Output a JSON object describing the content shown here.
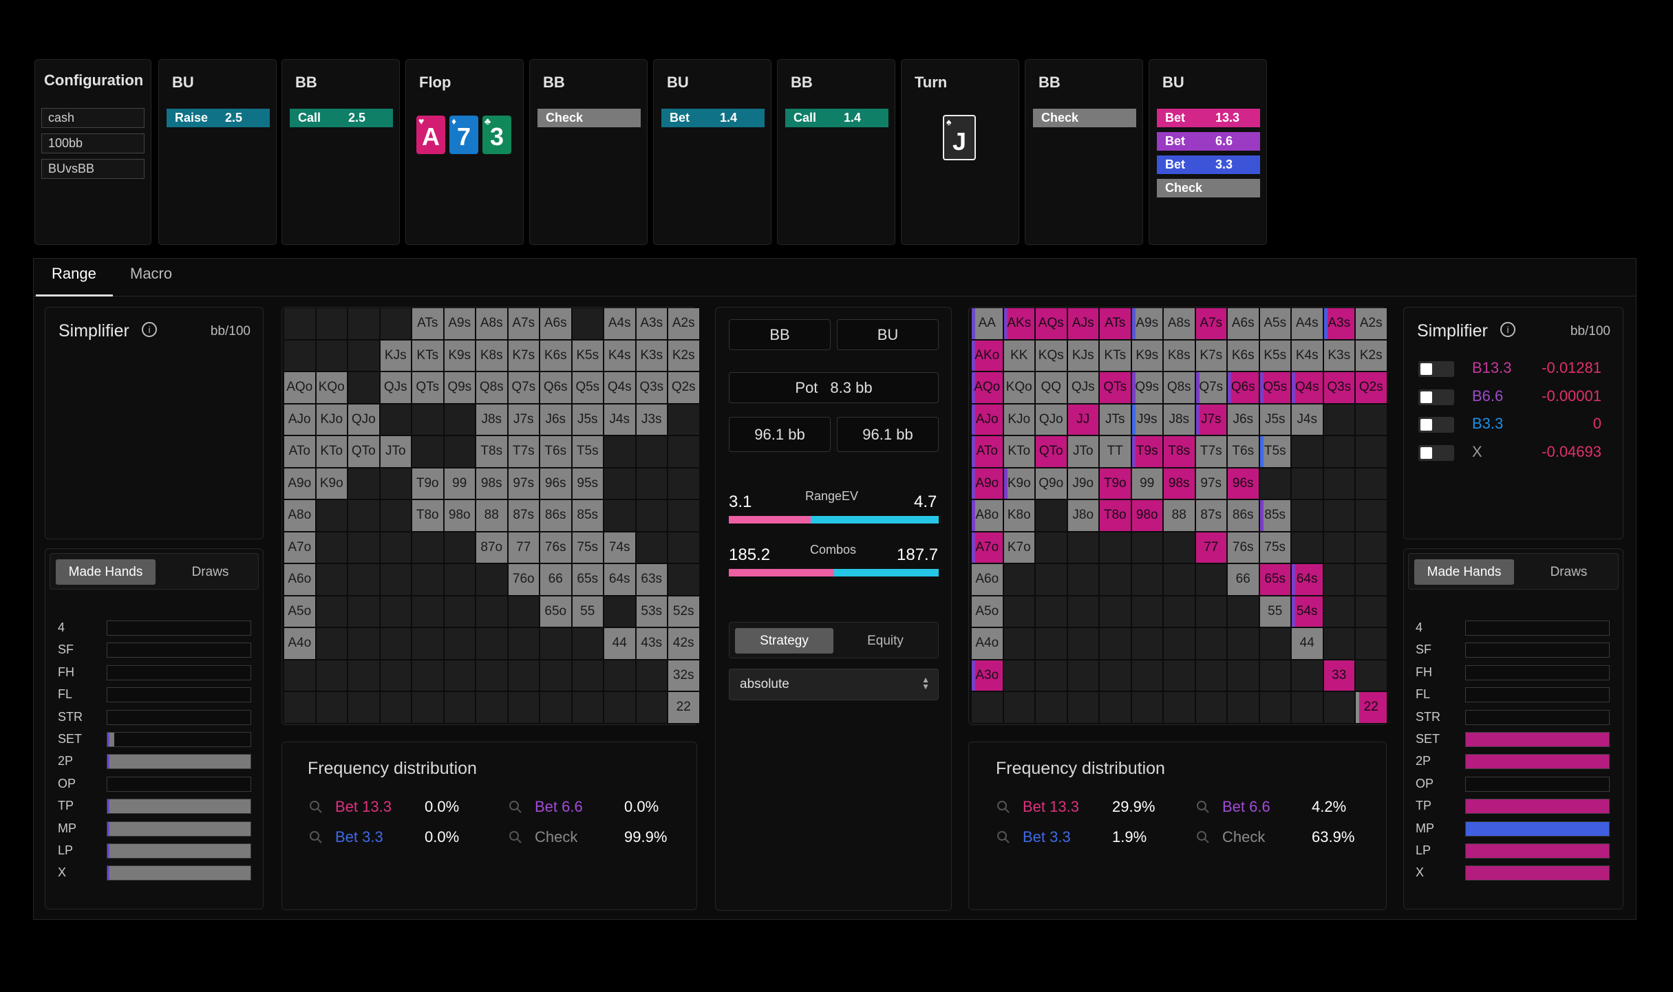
{
  "config": {
    "title": "Configuration",
    "items": [
      "cash",
      "100bb",
      "BUvsBB"
    ]
  },
  "nodes": [
    {
      "title": "BU",
      "actions": [
        {
          "label": "Raise",
          "value": "2.5",
          "color": "#0f7286"
        }
      ]
    },
    {
      "title": "BB",
      "actions": [
        {
          "label": "Call",
          "value": "2.5",
          "color": "#0f7f67"
        }
      ]
    },
    {
      "title": "Flop",
      "cards": [
        {
          "rank": "A",
          "suit": "♥",
          "color": "#d21d73"
        },
        {
          "rank": "7",
          "suit": "♦",
          "color": "#1679c9"
        },
        {
          "rank": "3",
          "suit": "♣",
          "color": "#11885a"
        }
      ]
    },
    {
      "title": "BB",
      "actions": [
        {
          "label": "Check",
          "value": "",
          "color": "#7a7a7a"
        }
      ]
    },
    {
      "title": "BU",
      "actions": [
        {
          "label": "Bet",
          "value": "1.4",
          "color": "#0f7286"
        }
      ]
    },
    {
      "title": "BB",
      "actions": [
        {
          "label": "Call",
          "value": "1.4",
          "color": "#0f7f67"
        }
      ]
    },
    {
      "title": "Turn",
      "cards": [
        {
          "rank": "J",
          "suit": "♠",
          "color": "#2a2a2a"
        }
      ]
    },
    {
      "title": "BB",
      "actions": [
        {
          "label": "Check",
          "value": "",
          "color": "#7a7a7a"
        }
      ]
    },
    {
      "title": "BU",
      "actions": [
        {
          "label": "Bet",
          "value": "13.3",
          "color": "#d2268a"
        },
        {
          "label": "Bet",
          "value": "6.6",
          "color": "#9b3bc4"
        },
        {
          "label": "Bet",
          "value": "3.3",
          "color": "#3c55d8"
        },
        {
          "label": "Check",
          "value": "",
          "color": "#7a7a7a"
        }
      ]
    }
  ],
  "tabs": {
    "range": "Range",
    "macro": "Macro"
  },
  "left": {
    "simplifier": "Simplifier",
    "unit": "bb/100",
    "seg": {
      "a": "Made Hands",
      "b": "Draws"
    },
    "hist": [
      {
        "label": "4",
        "fill": 0
      },
      {
        "label": "SF",
        "fill": 0
      },
      {
        "label": "FH",
        "fill": 0
      },
      {
        "label": "FL",
        "fill": 0
      },
      {
        "label": "STR",
        "fill": 0
      },
      {
        "label": "SET",
        "fill": 0.05
      },
      {
        "label": "2P",
        "fill": 1
      },
      {
        "label": "OP",
        "fill": 0
      },
      {
        "label": "TP",
        "fill": 1
      },
      {
        "label": "MP",
        "fill": 1
      },
      {
        "label": "LP",
        "fill": 1
      },
      {
        "label": "X",
        "fill": 1
      }
    ],
    "fd": {
      "title": "Frequency distribution",
      "items": [
        {
          "label": "Bet 13.3",
          "value": "0.0%",
          "color": "#e0317f"
        },
        {
          "label": "Bet 6.6",
          "value": "0.0%",
          "color": "#a44bd8"
        },
        {
          "label": "Bet 3.3",
          "value": "0.0%",
          "color": "#3f6ae8"
        },
        {
          "label": "Check",
          "value": "99.9%",
          "color": "#8a8a8a"
        }
      ]
    }
  },
  "center": {
    "players": [
      "BB",
      "BU"
    ],
    "pot_label": "Pot",
    "pot_value": "8.3 bb",
    "stacks": [
      "96.1 bb",
      "96.1 bb"
    ],
    "rangeev": {
      "label": "RangeEV",
      "left": "3.1",
      "right": "4.7"
    },
    "combos": {
      "label": "Combos",
      "left": "185.2",
      "right": "187.7"
    },
    "seg": {
      "a": "Strategy",
      "b": "Equity"
    },
    "select": "absolute"
  },
  "right": {
    "simplifier": "Simplifier",
    "unit": "bb/100",
    "rows": [
      {
        "label": "B13.3",
        "value": "-0.01281",
        "color": "#c43a9c",
        "vcolor": "#e0306e"
      },
      {
        "label": "B6.6",
        "value": "-0.00001",
        "color": "#9b4ccc",
        "vcolor": "#e0306e"
      },
      {
        "label": "B3.3",
        "value": "0",
        "color": "#1e90e8",
        "vcolor": "#e0306e"
      },
      {
        "label": "X",
        "value": "-0.04693",
        "color": "#9a9a9a",
        "vcolor": "#e0306e"
      }
    ],
    "seg": {
      "a": "Made Hands",
      "b": "Draws"
    },
    "hist": [
      {
        "label": "4",
        "fill": 0
      },
      {
        "label": "SF",
        "fill": 0
      },
      {
        "label": "FH",
        "fill": 0
      },
      {
        "label": "FL",
        "fill": 0
      },
      {
        "label": "STR",
        "fill": 0
      },
      {
        "label": "SET",
        "fill": 1
      },
      {
        "label": "2P",
        "fill": 1
      },
      {
        "label": "OP",
        "fill": 0
      },
      {
        "label": "TP",
        "fill": 1
      },
      {
        "label": "MP",
        "fill": 1
      },
      {
        "label": "LP",
        "fill": 1
      },
      {
        "label": "X",
        "fill": 1
      }
    ],
    "fd": {
      "title": "Frequency distribution",
      "items": [
        {
          "label": "Bet 13.3",
          "value": "29.9%",
          "color": "#e0317f"
        },
        {
          "label": "Bet 6.6",
          "value": "4.2%",
          "color": "#a44bd8"
        },
        {
          "label": "Bet 3.3",
          "value": "1.9%",
          "color": "#3f6ae8"
        },
        {
          "label": "Check",
          "value": "63.9%",
          "color": "#8a8a8a"
        }
      ]
    }
  },
  "grid_left": [
    [
      "",
      "",
      "",
      "",
      "ATs",
      "A9s",
      "A8s",
      "A7s",
      "A6s",
      "",
      "A4s",
      "A3s",
      "A2s"
    ],
    [
      "",
      "",
      "",
      "KJs",
      "KTs",
      "K9s",
      "K8s",
      "K7s",
      "K6s",
      "K5s",
      "K4s",
      "K3s",
      "K2s"
    ],
    [
      "AQo",
      "KQo",
      "",
      "QJs",
      "QTs",
      "Q9s",
      "Q8s",
      "Q7s",
      "Q6s",
      "Q5s",
      "Q4s",
      "Q3s",
      "Q2s"
    ],
    [
      "AJo",
      "KJo",
      "QJo",
      "",
      "",
      "",
      "J8s",
      "J7s",
      "J6s",
      "J5s",
      "J4s",
      "J3s",
      ""
    ],
    [
      "ATo",
      "KTo",
      "QTo",
      "JTo",
      "",
      "",
      "T8s",
      "T7s",
      "T6s",
      "T5s",
      "",
      "",
      ""
    ],
    [
      "A9o",
      "K9o",
      "",
      "",
      "T9o",
      "99",
      "98s",
      "97s",
      "96s",
      "95s",
      "",
      "",
      ""
    ],
    [
      "A8o",
      "",
      "",
      "",
      "T8o",
      "98o",
      "88",
      "87s",
      "86s",
      "85s",
      "",
      "",
      ""
    ],
    [
      "A7o",
      "",
      "",
      "",
      "",
      "",
      "87o",
      "77",
      "76s",
      "75s",
      "74s",
      "",
      ""
    ],
    [
      "A6o",
      "",
      "",
      "",
      "",
      "",
      "",
      "76o",
      "66",
      "65s",
      "64s",
      "63s",
      ""
    ],
    [
      "A5o",
      "",
      "",
      "",
      "",
      "",
      "",
      "",
      "65o",
      "55",
      "",
      "53s",
      "52s"
    ],
    [
      "A4o",
      "",
      "",
      "",
      "",
      "",
      "",
      "",
      "",
      "",
      "44",
      "43s",
      "42s"
    ],
    [
      "",
      "",
      "",
      "",
      "",
      "",
      "",
      "",
      "",
      "",
      "",
      "",
      "32s"
    ],
    [
      "",
      "",
      "",
      "",
      "",
      "",
      "",
      "",
      "",
      "",
      "",
      "",
      "22"
    ]
  ],
  "grid_right": [
    [
      "AA",
      "AKs",
      "AQs",
      "AJs",
      "ATs",
      "A9s",
      "A8s",
      "A7s",
      "A6s",
      "A5s",
      "A4s",
      "A3s",
      "A2s"
    ],
    [
      "AKo",
      "KK",
      "KQs",
      "KJs",
      "KTs",
      "K9s",
      "K8s",
      "K7s",
      "K6s",
      "K5s",
      "K4s",
      "K3s",
      "K2s"
    ],
    [
      "AQo",
      "KQo",
      "QQ",
      "QJs",
      "QTs",
      "Q9s",
      "Q8s",
      "Q7s",
      "Q6s",
      "Q5s",
      "Q4s",
      "Q3s",
      "Q2s"
    ],
    [
      "AJo",
      "KJo",
      "QJo",
      "JJ",
      "JTs",
      "J9s",
      "J8s",
      "J7s",
      "J6s",
      "J5s",
      "J4s",
      "",
      ""
    ],
    [
      "ATo",
      "KTo",
      "QTo",
      "JTo",
      "TT",
      "T9s",
      "T8s",
      "T7s",
      "T6s",
      "T5s",
      "",
      "",
      ""
    ],
    [
      "A9o",
      "K9o",
      "Q9o",
      "J9o",
      "T9o",
      "99",
      "98s",
      "97s",
      "96s",
      "",
      "",
      "",
      ""
    ],
    [
      "A8o",
      "K8o",
      "",
      "J8o",
      "T8o",
      "98o",
      "88",
      "87s",
      "86s",
      "85s",
      "",
      "",
      ""
    ],
    [
      "A7o",
      "K7o",
      "",
      "",
      "",
      "",
      "",
      "77",
      "76s",
      "75s",
      "",
      "",
      ""
    ],
    [
      "A6o",
      "",
      "",
      "",
      "",
      "",
      "",
      "",
      "66",
      "65s",
      "64s",
      "",
      ""
    ],
    [
      "A5o",
      "",
      "",
      "",
      "",
      "",
      "",
      "",
      "",
      "55",
      "54s",
      "",
      ""
    ],
    [
      "A4o",
      "",
      "",
      "",
      "",
      "",
      "",
      "",
      "",
      "",
      "44",
      "",
      ""
    ],
    [
      "A3o",
      "",
      "",
      "",
      "",
      "",
      "",
      "",
      "",
      "",
      "",
      "33",
      ""
    ],
    [
      "",
      "",
      "",
      "",
      "",
      "",
      "",
      "",
      "",
      "",
      "",
      "",
      "22"
    ]
  ],
  "grid_right_colors": {
    "AKs": "#c0187f",
    "AQs": "#c0187f",
    "AJs": "#c0187f",
    "QTs": "#c0187f",
    "JJ": "#c0187f",
    "T9o": "#c0187f",
    "98s": "#c0187f",
    "T8o": "#c0187f",
    "98o": "#c0187f",
    "A7o": "#c0187f",
    "77": "#c0187f",
    "33": "#c0187f",
    "22": "#c0187f",
    "Q6s": "#c0187f",
    "Q5s": "#c0187f",
    "Q4s": "#c0187f",
    "Q3s": "#c0187f",
    "Q2s": "#c0187f",
    "65s": "#c0187f",
    "64s": "#c0187f",
    "54s": "#c0187f",
    "A7s": "#c0187f",
    "J7s": "#c0187f",
    "T9s": "#c0187f",
    "T8s": "#c0187f",
    "AQo": "#c0187f",
    "AJo": "#c0187f",
    "ATo": "#c0187f",
    "A9o": "#c0187f",
    "AKo": "#c0187f",
    "QTo": "#c0187f",
    "96s": "#c0187f",
    "ATs": "#c0187f",
    "A3s": "#c0187f",
    "A3o": "#c0187f"
  },
  "grid_right_stripes": {
    "AA": "#6a4ac9",
    "AKs": "#7a3ec9",
    "A9s": "#5a55d9",
    "A3s": "#4a5ae0",
    "Q9s": "#7a3ec9",
    "Q7s": "#7a3ec9",
    "Q6s": "#7a3ec9",
    "Q5s": "#7a3ec9",
    "Q4s": "#7a3ec9",
    "AKo": "#7a3ec9",
    "AQo": "#7a3ec9",
    "AJo": "#7a3ec9",
    "A9o": "#7a3ec9",
    "A8o": "#7a3ec9",
    "A7o": "#7a3ec9",
    "A3o": "#7a3ec9",
    "ATo": "#7a3ec9",
    "J7s": "#7a3ec9",
    "T9s": "#7a3ec9",
    "T5s": "#3f6ae8",
    "85s": "#7a3ec9",
    "54s": "#7a3ec9",
    "64s": "#7a3ec9",
    "J9s": "#3f6ae8",
    "K9o": "#7a3ec9",
    "22": "#8a8a8a"
  }
}
